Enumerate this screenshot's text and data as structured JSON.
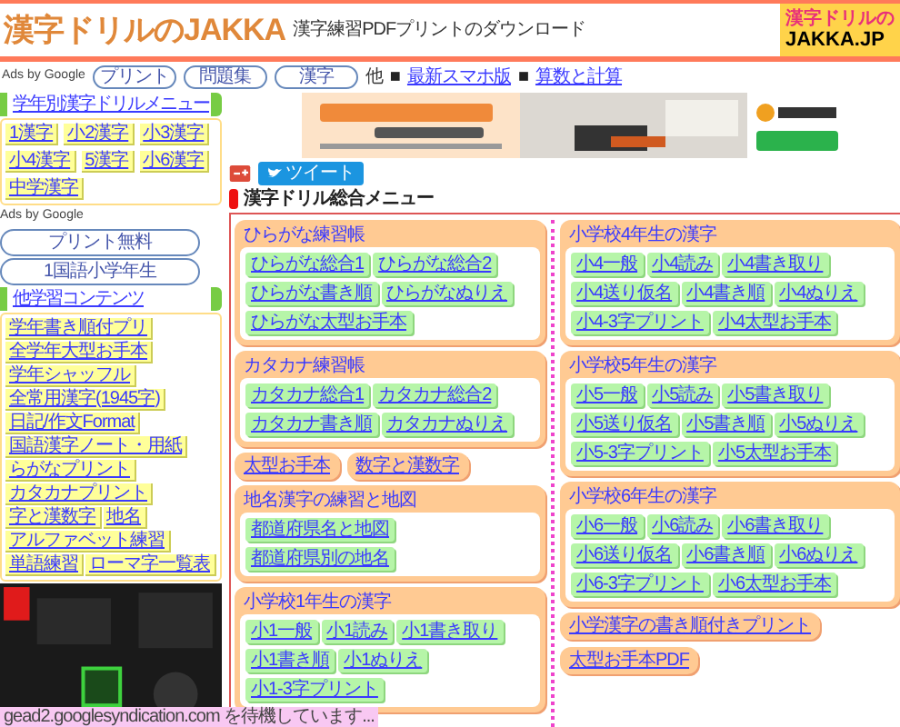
{
  "header": {
    "logo": "漢字ドリルのJAKKA",
    "tagline": "漢字練習PDFプリントのダウンロード",
    "badge_top": "漢字ドリルの",
    "badge_bottom": "JAKKA.JP"
  },
  "nav": {
    "ads_label": "Ads by Google",
    "tabs": [
      "プリント",
      "問題集",
      "漢字"
    ],
    "prefix": "他",
    "links": [
      {
        "separator": "■",
        "label": "最新スマホ版"
      },
      {
        "separator": "■",
        "label": "算数と計算"
      }
    ]
  },
  "sidebar": {
    "menu_title": "学年別漢字ドリルメニュー",
    "grade_links": [
      "1漢字",
      "小2漢字",
      "小3漢字",
      "小4漢字",
      "5漢字",
      "小6漢字",
      "中学漢字"
    ],
    "ads_label": "Ads by Google",
    "ad_links": [
      "プリント無料",
      "1国語小学年生"
    ],
    "other_title": "他学習コンテンツ",
    "other_links": [
      "学年書き順付プリ",
      "全学年大型お手本",
      "学年シャッフル",
      "全常用漢字(1945字)",
      "日記/作文Format",
      "国語漢字ノート・用紙",
      "らがなプリント",
      "カタカナプリント",
      "字と漢数字",
      "地名",
      "アルファベット練習",
      "単語練習",
      "ローマ字一覧表"
    ],
    "ad": {
      "kind": "picture"
    }
  },
  "main": {
    "banner": {
      "kind": "picture"
    },
    "tweet": "ツイート",
    "title": "漢字ドリル総合メニュー",
    "columns": [
      [
        {
          "kind": "group",
          "title": "ひらがな練習帳",
          "links": [
            "ひらがな総合1",
            "ひらがな総合2",
            "ひらがな書き順",
            "ひらがなぬりえ",
            "ひらがな太型お手本"
          ]
        },
        {
          "kind": "group",
          "title": "カタカナ練習帳",
          "links": [
            "カタカナ総合1",
            "カタカナ総合2",
            "カタカナ書き順",
            "カタカナぬりえ"
          ]
        },
        {
          "kind": "pills",
          "links": [
            "太型お手本",
            "数字と漢数字"
          ]
        },
        {
          "kind": "group",
          "title": "地名漢字の練習と地図",
          "links": [
            "都道府県名と地図",
            "都道府県別の地名"
          ]
        },
        {
          "kind": "group",
          "title": "小学校1年生の漢字",
          "links": [
            "小1一般",
            "小1読み",
            "小1書き取り",
            "小1書き順",
            "小1ぬりえ",
            "小1-3字プリント"
          ]
        }
      ],
      [
        {
          "kind": "group",
          "title": "小学校4年生の漢字",
          "links": [
            "小4一般",
            "小4読み",
            "小4書き取り",
            "小4送り仮名",
            "小4書き順",
            "小4ぬりえ",
            "小4-3字プリント",
            "小4太型お手本"
          ]
        },
        {
          "kind": "group",
          "title": "小学校5年生の漢字",
          "links": [
            "小5一般",
            "小5読み",
            "小5書き取り",
            "小5送り仮名",
            "小5書き順",
            "小5ぬりえ",
            "小5-3字プリント",
            "小5太型お手本"
          ]
        },
        {
          "kind": "group",
          "title": "小学校6年生の漢字",
          "links": [
            "小6一般",
            "小6読み",
            "小6書き取り",
            "小6送り仮名",
            "小6書き順",
            "小6ぬりえ",
            "小6-3字プリント",
            "小6太型お手本"
          ]
        },
        {
          "kind": "pills",
          "links": [
            "小学漢字の書き順付きプリント",
            "太型お手本PDF"
          ]
        }
      ]
    ]
  },
  "status_bar": "gead2.googlesyndication.com を待機しています..."
}
